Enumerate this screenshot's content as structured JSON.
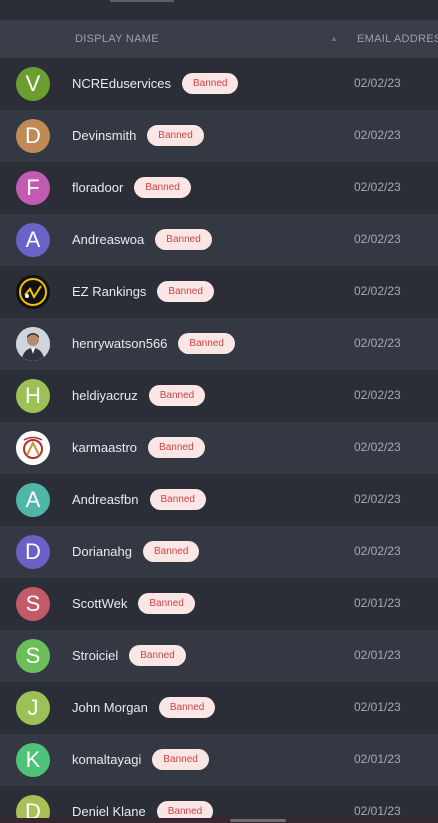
{
  "table": {
    "headers": {
      "display_name": "DISPLAY NAME",
      "email_address": "EMAIL ADDRES"
    },
    "sort_icon": "sort-up-icon",
    "rows": [
      {
        "name": "NCREduservices",
        "status": "Banned",
        "date": "02/02/23",
        "initial": "V",
        "avatar_color": "#6b9e2e",
        "avatar_type": "initial"
      },
      {
        "name": "Devinsmith",
        "status": "Banned",
        "date": "02/02/23",
        "initial": "D",
        "avatar_color": "#c08a55",
        "avatar_type": "initial"
      },
      {
        "name": "floradoor",
        "status": "Banned",
        "date": "02/02/23",
        "initial": "F",
        "avatar_color": "#c25bb1",
        "avatar_type": "initial"
      },
      {
        "name": "Andreaswoa",
        "status": "Banned",
        "date": "02/02/23",
        "initial": "A",
        "avatar_color": "#6a63c9",
        "avatar_type": "initial"
      },
      {
        "name": "EZ Rankings",
        "status": "Banned",
        "date": "02/02/23",
        "initial": "",
        "avatar_color": "#111111",
        "avatar_type": "ez-logo"
      },
      {
        "name": "henrywatson566",
        "status": "Banned",
        "date": "02/02/23",
        "initial": "",
        "avatar_color": "#c9ced6",
        "avatar_type": "photo"
      },
      {
        "name": "heldiyacruz",
        "status": "Banned",
        "date": "02/02/23",
        "initial": "H",
        "avatar_color": "#9cc156",
        "avatar_type": "initial"
      },
      {
        "name": "karmaastro",
        "status": "Banned",
        "date": "02/02/23",
        "initial": "",
        "avatar_color": "#ffffff",
        "avatar_type": "astro-logo"
      },
      {
        "name": "Andreasfbn",
        "status": "Banned",
        "date": "02/02/23",
        "initial": "A",
        "avatar_color": "#4fb6a8",
        "avatar_type": "initial"
      },
      {
        "name": "Dorianahg",
        "status": "Banned",
        "date": "02/02/23",
        "initial": "D",
        "avatar_color": "#6c5fc7",
        "avatar_type": "initial"
      },
      {
        "name": "ScottWek",
        "status": "Banned",
        "date": "02/01/23",
        "initial": "S",
        "avatar_color": "#c25a6a",
        "avatar_type": "initial"
      },
      {
        "name": "Stroiciel",
        "status": "Banned",
        "date": "02/01/23",
        "initial": "S",
        "avatar_color": "#6abf5a",
        "avatar_type": "initial"
      },
      {
        "name": "John Morgan",
        "status": "Banned",
        "date": "02/01/23",
        "initial": "J",
        "avatar_color": "#9cc156",
        "avatar_type": "initial"
      },
      {
        "name": "komaltayagi",
        "status": "Banned",
        "date": "02/01/23",
        "initial": "K",
        "avatar_color": "#4fc27a",
        "avatar_type": "initial"
      },
      {
        "name": "Deniel Klane",
        "status": "Banned",
        "date": "02/01/23",
        "initial": "D",
        "avatar_color": "#a8c156",
        "avatar_type": "initial"
      }
    ]
  },
  "colors": {
    "background": "#2b2e36",
    "row_alt": "#343843",
    "header_bg": "#3a3e49",
    "badge_bg": "#fbe6e6",
    "badge_text": "#d04444"
  }
}
